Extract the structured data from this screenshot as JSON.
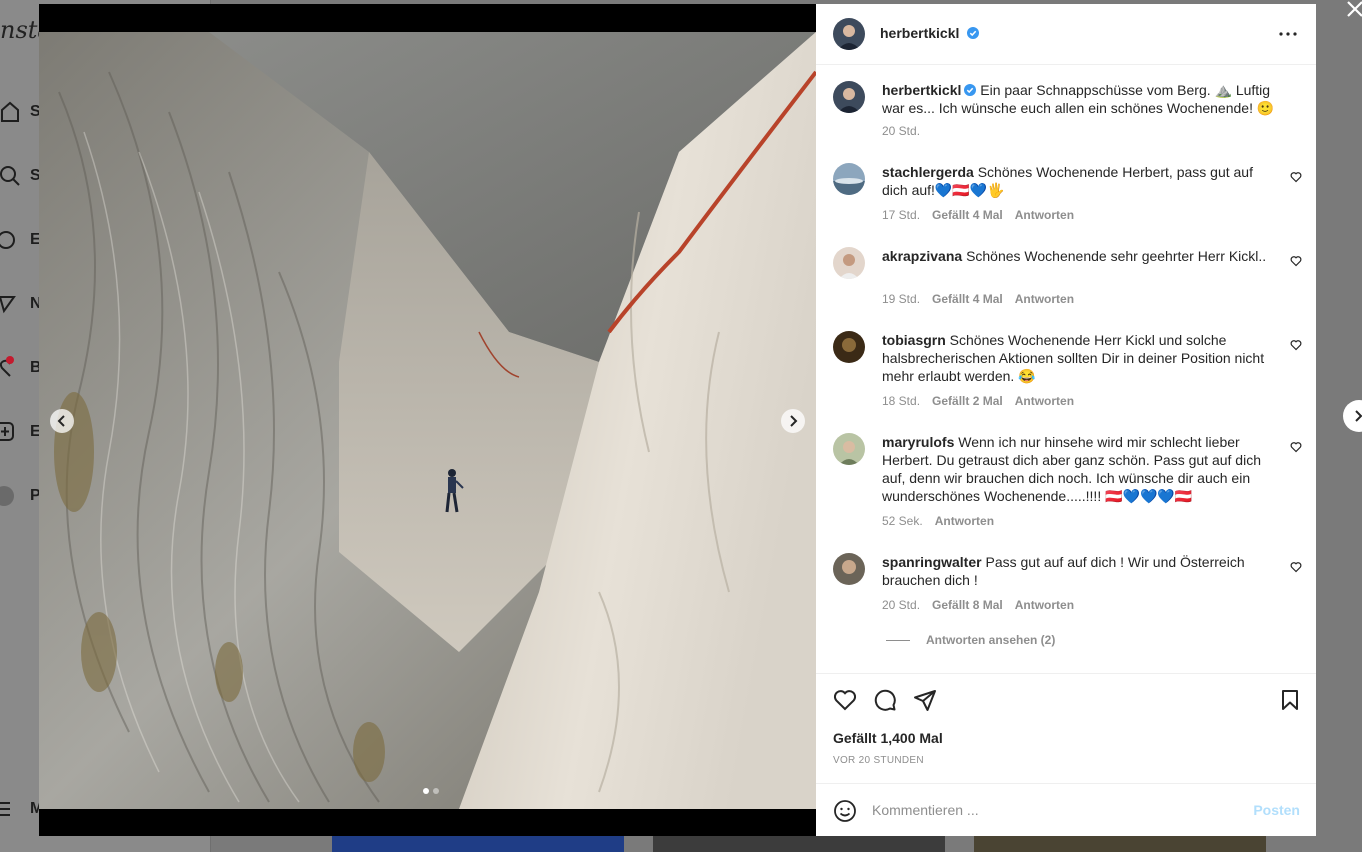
{
  "background": {
    "logo": "nsta",
    "nav_fragments": [
      "S",
      "S",
      "E",
      "N",
      "B",
      "E",
      "P",
      "M"
    ]
  },
  "post": {
    "author": "herbertkickl",
    "caption": {
      "username": "herbertkickl",
      "text": "Ein paar Schnappschüsse vom Berg. ⛰️ Luftig war es... Ich wünsche euch allen ein schönes Wochenende! 🙂",
      "time": "20 Std."
    },
    "comments": [
      {
        "username": "stachlergerda",
        "text": "Schönes Wochenende Herbert, pass gut auf dich auf!💙🇦🇹💙🖐",
        "time": "17 Std.",
        "likes": "Gefällt 4 Mal",
        "reply": "Antworten"
      },
      {
        "username": "akrapzivana",
        "text": "Schönes Wochenende sehr geehrter Herr Kickl..",
        "time": "19 Std.",
        "likes": "Gefällt 4 Mal",
        "reply": "Antworten"
      },
      {
        "username": "tobiasgrn",
        "text": "Schönes Wochenende Herr Kickl und solche halsbrecherischen Aktionen sollten Dir in deiner Position nicht mehr erlaubt werden. 😂",
        "time": "18 Std.",
        "likes": "Gefällt 2 Mal",
        "reply": "Antworten"
      },
      {
        "username": "maryrulofs",
        "text": "Wenn ich nur hinsehe wird mir schlecht lieber Herbert. Du getraust dich aber ganz schön. Pass gut auf dich auf, denn wir brauchen dich noch. Ich wünsche dir auch ein wunderschönes Wochenende.....!!!! 🇦🇹💙💙💙🇦🇹",
        "time": "52 Sek.",
        "likes": "",
        "reply": "Antworten"
      },
      {
        "username": "spanringwalter",
        "text": "Pass gut auf auf dich ! Wir und Österreich brauchen dich !",
        "time": "20 Std.",
        "likes": "Gefällt 8 Mal",
        "reply": "Antworten"
      }
    ],
    "view_replies": "Antworten ansehen (2)",
    "likes": "Gefällt 1,400 Mal",
    "posted": "VOR 20 STUNDEN",
    "comment_placeholder": "Kommentieren ...",
    "post_button": "Posten",
    "carousel": {
      "total": 2,
      "active": 1
    }
  },
  "colors": {
    "verified": "#3897f0",
    "link_disabled": "#b2dffc",
    "rope": "#b8432a"
  }
}
